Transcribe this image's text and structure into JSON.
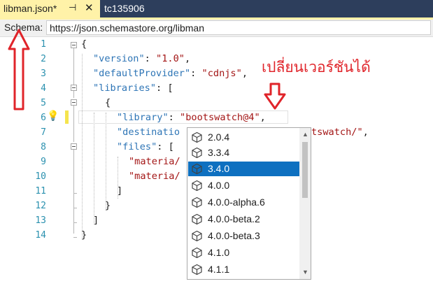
{
  "tabs": {
    "active": {
      "label": "libman.json*",
      "pin_icon": "pin-icon",
      "close_icon": "close-icon"
    },
    "inactive": {
      "label": "tc135906"
    }
  },
  "schema": {
    "label": "Schema:",
    "url": "https://json.schemastore.org/libman"
  },
  "editor": {
    "line_numbers": [
      "1",
      "2",
      "3",
      "4",
      "5",
      "6",
      "7",
      "8",
      "9",
      "10",
      "11",
      "12",
      "13",
      "14"
    ],
    "lines": {
      "l1": "{",
      "l2_key": "\"version\"",
      "l2_colon": ": ",
      "l2_val": "\"1.0\"",
      "l2_end": ",",
      "l3_key": "\"defaultProvider\"",
      "l3_colon": ": ",
      "l3_val": "\"cdnjs\"",
      "l3_end": ",",
      "l4_key": "\"libraries\"",
      "l4_rest": ": [",
      "l5": "{",
      "l6_key": "\"library\"",
      "l6_colon": ": ",
      "l6_val": "\"bootswatch@4\"",
      "l6_end": ",",
      "l7_key": "\"destinatio",
      "l7_val": "tswatch/\"",
      "l7_end": ",",
      "l8_key": "\"files\"",
      "l8_rest": ": [",
      "l9_val": "\"materia/",
      "l10_val": "\"materia/",
      "l11": "]",
      "l12": "}",
      "l13": "]",
      "l14": "}"
    }
  },
  "completion": {
    "items": [
      "2.0.4",
      "3.3.4",
      "3.4.0",
      "4.0.0",
      "4.0.0-alpha.6",
      "4.0.0-beta.2",
      "4.0.0-beta.3",
      "4.1.0",
      "4.1.1"
    ],
    "selected_index": 2,
    "item_icon": "package-cube-icon"
  },
  "annotation": {
    "text": "เปลี่ยนเวอร์ชันได้",
    "color": "#e0242a"
  },
  "colors": {
    "tab_active_bg": "#fff2a8",
    "tabbar_bg": "#2d3e5c",
    "selection": "#0e70c0",
    "json_key": "#2e75b6",
    "json_string": "#a31515",
    "line_number": "#2b91af"
  }
}
